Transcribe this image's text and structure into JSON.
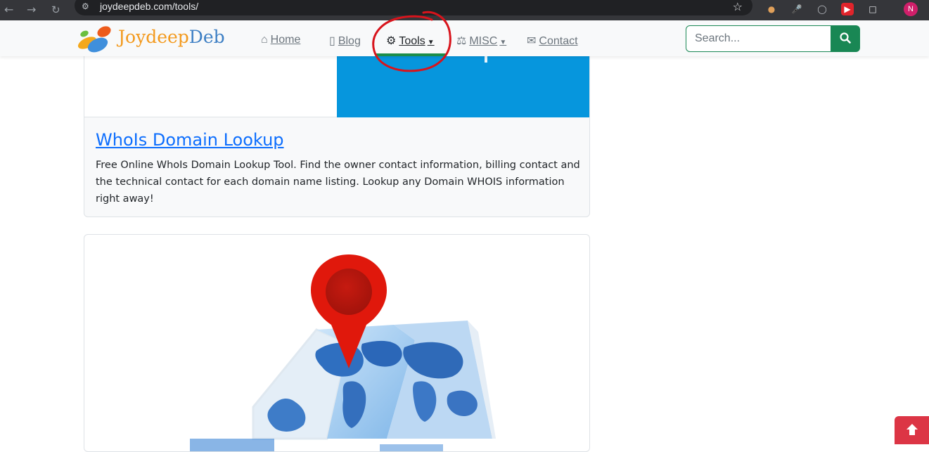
{
  "browser": {
    "url": "joydeepdeb.com/tools/",
    "profile_initial": "N"
  },
  "brand": {
    "part1": "Joydeep",
    "part2": "Deb"
  },
  "nav": {
    "home": "Home",
    "blog": "Blog",
    "tools": "Tools",
    "misc": "MISC",
    "contact": "Contact"
  },
  "search": {
    "placeholder": "Search..."
  },
  "cards": [
    {
      "title": "WhoIs Domain Lookup",
      "description": "Free Online WhoIs Domain Lookup Tool. Find the owner contact information, billing contact and the technical contact for each domain name listing. Lookup any Domain WHOIS information right away!"
    }
  ],
  "colors": {
    "accent": "#198754",
    "link": "#0d6efd",
    "card_blue": "#0696dd",
    "pin_red": "#e0180c",
    "back_to_top": "#dc3545"
  }
}
